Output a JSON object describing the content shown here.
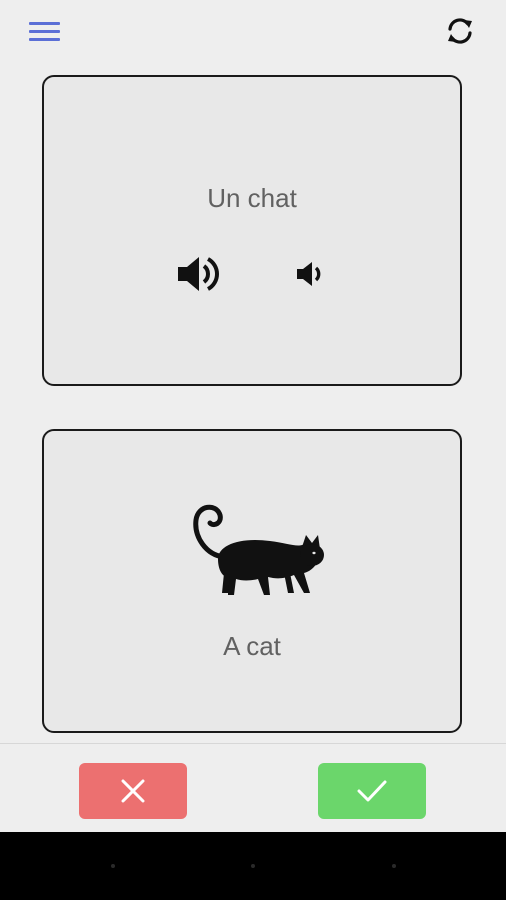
{
  "toolbar": {
    "menu_icon": "hamburger-menu-icon",
    "refresh_icon": "refresh-icon"
  },
  "front_card": {
    "word": "Un chat",
    "audio_normal_icon": "speaker-loud-icon",
    "audio_slow_icon": "speaker-soft-icon"
  },
  "back_card": {
    "translation": "A cat",
    "image_icon": "cat-icon"
  },
  "actions": {
    "wrong_icon": "close-icon",
    "right_icon": "check-icon"
  },
  "colors": {
    "accent": "#5b6fd6",
    "wrong": "#ec7070",
    "right": "#6bd66b",
    "text": "#616161"
  }
}
